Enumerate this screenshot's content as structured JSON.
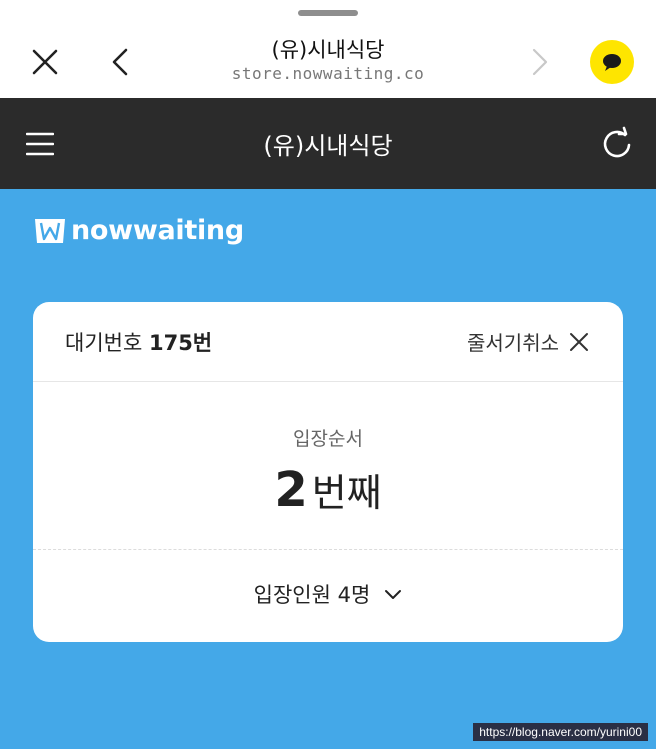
{
  "browser": {
    "title": "(유)시내식당",
    "url": "store.nowwaiting.co"
  },
  "header": {
    "title": "(유)시내식당"
  },
  "brand": {
    "name": "nowwaiting",
    "color": "#44a8e8"
  },
  "card": {
    "wait_label": "대기번호",
    "wait_number": "175번",
    "cancel_label": "줄서기취소",
    "order_label": "입장순서",
    "order_number": "2",
    "order_suffix": "번째",
    "party_label": "입장인원 4명"
  },
  "watermark": "https://blog.naver.com/yurini00",
  "icons": [
    "close-icon",
    "back-icon",
    "forward-icon",
    "kakaotalk-icon",
    "menu-icon",
    "refresh-icon",
    "nowwaiting-logo-icon",
    "close-x-icon",
    "chevron-down-icon"
  ]
}
